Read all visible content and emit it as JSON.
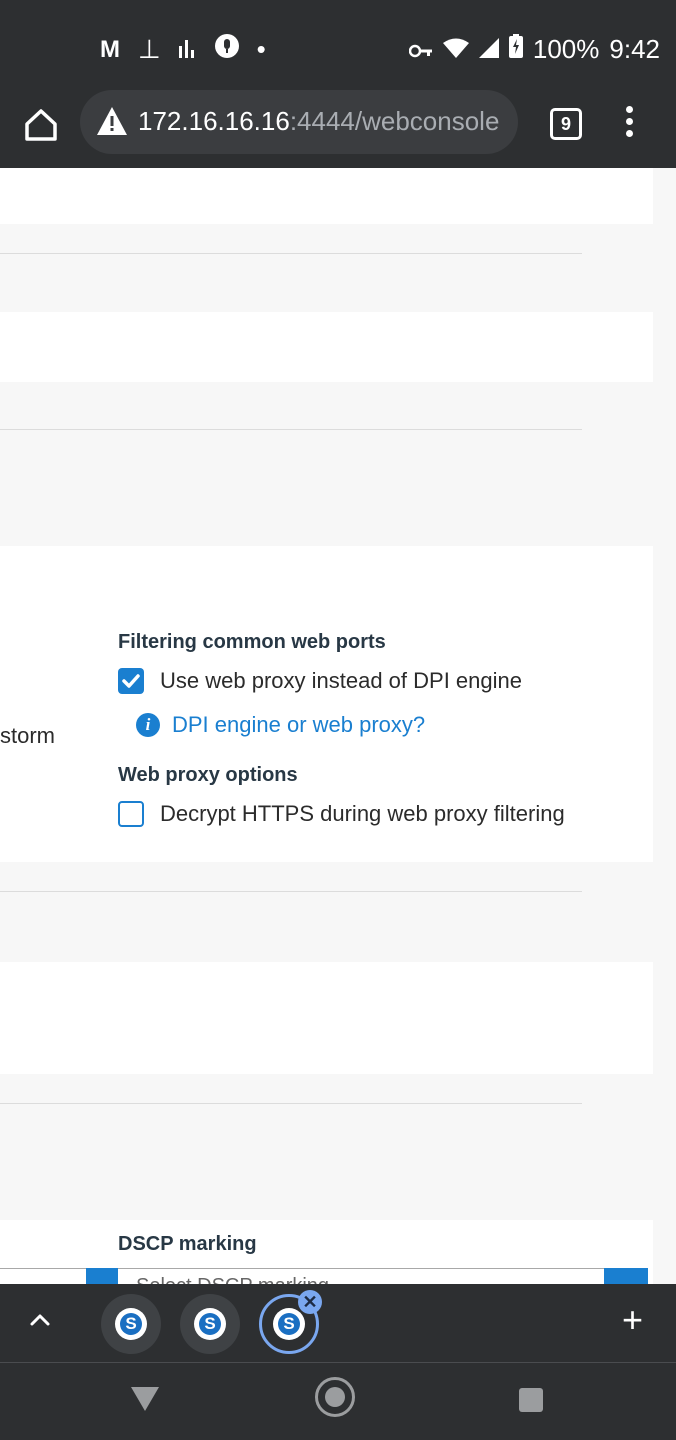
{
  "status_bar": {
    "left_icons": [
      "gmail-icon",
      "android-debug-icon",
      "signal-bars-icon",
      "mic-icon",
      "dot-icon"
    ],
    "battery": "100%",
    "time": "9:42"
  },
  "browser": {
    "url_host": "172.16.16.16",
    "url_rest": ":4444/webconsole",
    "tab_count": "9"
  },
  "web_settings": {
    "filtering_heading": "Filtering common web ports",
    "use_proxy_label": "Use web proxy instead of DPI engine",
    "use_proxy_checked": true,
    "dpi_help_link": "DPI engine or web proxy?",
    "web_proxy_heading": "Web proxy options",
    "decrypt_label": "Decrypt HTTPS during web proxy filtering",
    "decrypt_checked": false,
    "partial_left_label": "storm"
  },
  "dscp": {
    "heading": "DSCP marking",
    "select_placeholder": "Select DSCP marking"
  },
  "tab_switcher": {
    "favicon_letter": "S"
  },
  "colors": {
    "accent": "#1a7fd0",
    "chrome_dark": "#2d2f31"
  }
}
